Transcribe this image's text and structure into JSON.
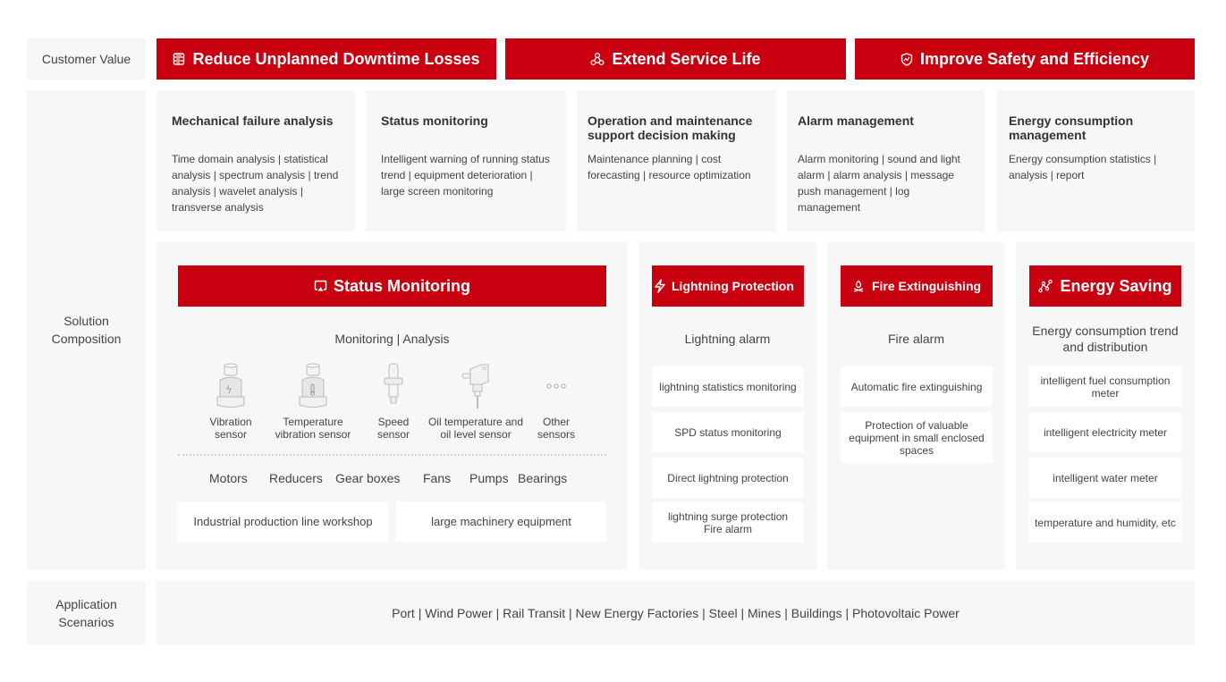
{
  "rows": {
    "customer_value": "Customer Value",
    "solution_composition": "Solution\nComposition",
    "application_scenarios": "Application\nScenarios"
  },
  "customer_values": [
    {
      "label": "Reduce Unplanned Downtime Losses",
      "icon": "server-stack-icon"
    },
    {
      "label": "Extend Service Life",
      "icon": "network-nodes-icon"
    },
    {
      "label": "Improve Safety and Efficiency",
      "icon": "shield-pulse-icon"
    }
  ],
  "features": [
    {
      "title": "Mechanical failure analysis",
      "desc": "Time domain analysis | statistical analysis | spectrum analysis | trend analysis | wavelet analysis | transverse analysis"
    },
    {
      "title": "Status monitoring",
      "desc": "Intelligent warning of running status trend | equipment deterioration | large screen monitoring"
    },
    {
      "title": "Operation and maintenance support decision making",
      "desc": "Maintenance planning | cost forecasting | resource optimization"
    },
    {
      "title": "Alarm management",
      "desc": "Alarm monitoring | sound and light alarm | alarm analysis | message push management | log management"
    },
    {
      "title": "Energy consumption management",
      "desc": "Energy consumption statistics | analysis | report"
    }
  ],
  "status_monitoring": {
    "title": "Status Monitoring",
    "icon": "screen-cast-icon",
    "subtitle": "Monitoring | Analysis",
    "sensors": [
      {
        "label": "Vibration sensor",
        "icon": "vibration-sensor-icon"
      },
      {
        "label": "Temperature vibration sensor",
        "icon": "temperature-sensor-icon"
      },
      {
        "label": "Speed sensor",
        "icon": "speed-sensor-icon"
      },
      {
        "label": "Oil temperature and oil level sensor",
        "icon": "oil-sensor-icon"
      },
      {
        "label": "Other sensors",
        "icon": "more-dots-icon"
      }
    ],
    "equipment": [
      "Motors",
      "Reducers",
      "Gear boxes",
      "Fans",
      "Pumps",
      "Bearings"
    ],
    "scenes": [
      "Industrial production line workshop",
      "large machinery equipment"
    ]
  },
  "lightning": {
    "title": "Lightning Protection",
    "icon": "lightning-icon",
    "subtitle": "Lightning alarm",
    "items": [
      "lightning statistics monitoring",
      "SPD status monitoring",
      "Direct lightning protection",
      "lightning surge protection Fire alarm"
    ]
  },
  "fire": {
    "title": "Fire Extinguishing",
    "icon": "campfire-icon",
    "subtitle": "Fire alarm",
    "items": [
      "Automatic fire extinguishing",
      "Protection of valuable equipment in small enclosed spaces"
    ]
  },
  "energy": {
    "title": "Energy Saving",
    "icon": "trend-line-icon",
    "subtitle": "Energy consumption trend and distribution",
    "items": [
      "intelligent fuel consumption meter",
      "intelligent electricity meter",
      "intelligent water meter",
      "temperature and humidity, etc"
    ]
  },
  "scenarios": "Port | Wind Power | Rail Transit | New Energy Factories | Steel | Mines | Buildings | Photovoltaic Power",
  "colors": {
    "accent": "#c8000f",
    "panel": "#f7f7f7",
    "card": "#ffffff",
    "text": "#333333"
  }
}
